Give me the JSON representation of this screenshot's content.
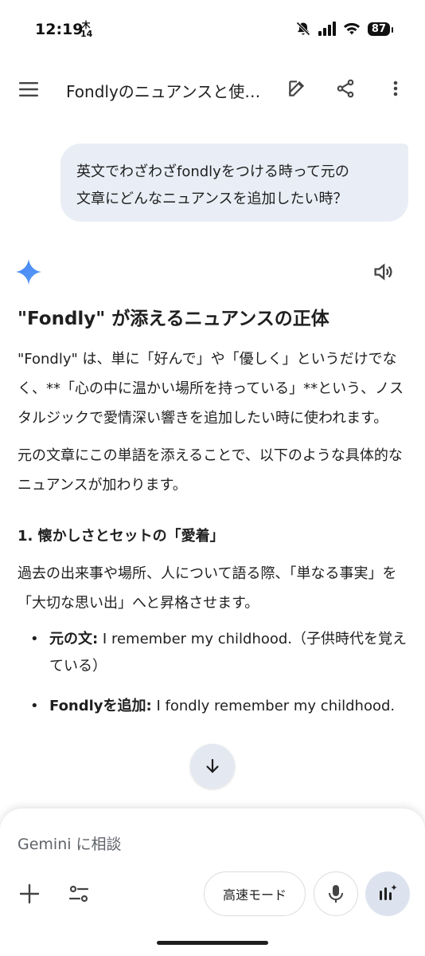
{
  "status_bar": {
    "time": "12:19",
    "tag_top": "木",
    "tag_bottom": "14",
    "battery": "87"
  },
  "app_bar": {
    "title": "Fondlyのニュアンスと使…",
    "icons": [
      "menu-icon",
      "edit-icon",
      "share-icon",
      "more-vert-icon"
    ]
  },
  "user_message": {
    "line1": "英文でわざわざfondlyをつける時って元の",
    "line2": "文章にどんなニュアンスを追加したい時？"
  },
  "response": {
    "heading": "\"Fondly\" が添えるニュアンスの正体",
    "para1": "\"Fondly\" は、単に「好んで」や「優しく」というだけでなく、**「心の中に温かい場所を持っている」**という、ノスタルジックで愛情深い響きを追加したい時に使われます。",
    "para2": "元の文章にこの単語を添えることで、以下のような具体的なニュアンスが加わります。",
    "section1_title": "1. 懐かしさとセットの「愛着」",
    "section1_body": "過去の出来事や場所、人について語る際、「単なる事実」を「大切な思い出」へと昇格させます。",
    "bullets": [
      {
        "label": "元の文:",
        "text": " I remember my childhood.（子供時代を覚えている）"
      },
      {
        "label": "Fondlyを追加:",
        "text": " I fondly remember my childhood."
      }
    ]
  },
  "input_panel": {
    "placeholder": "Gemini に相談",
    "mode_label": "高速モード"
  },
  "colors": {
    "bubble": "#e9eef6",
    "gemini_blue": "#4285f4",
    "fab": "#e4e9f1",
    "live_button": "#dde3ee"
  }
}
